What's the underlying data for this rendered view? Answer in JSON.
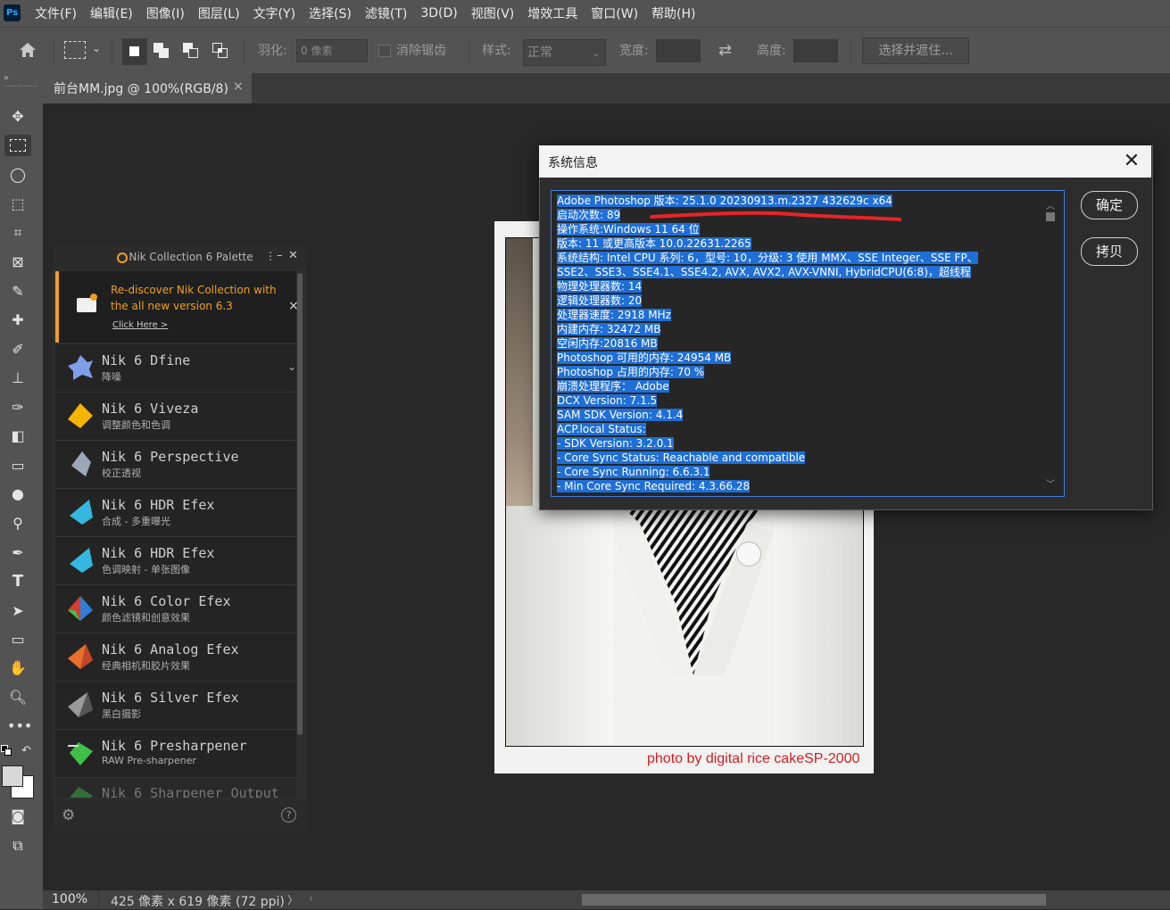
{
  "app": {
    "logo": "Ps"
  },
  "menu": [
    "文件(F)",
    "编辑(E)",
    "图像(I)",
    "图层(L)",
    "文字(Y)",
    "选择(S)",
    "滤镜(T)",
    "3D(D)",
    "视图(V)",
    "增效工具",
    "窗口(W)",
    "帮助(H)"
  ],
  "options": {
    "feather_label": "羽化:",
    "feather_value": "0 像素",
    "antialias_label": "消除锯齿",
    "style_label": "样式:",
    "style_value": "正常",
    "width_label": "宽度:",
    "height_label": "高度:",
    "select_mask_label": "选择并遮住..."
  },
  "tab": {
    "title": "前台MM.jpg @ 100%(RGB/8)",
    "close": "×"
  },
  "nik": {
    "title": "Nik Collection 6 Palette",
    "banner_line1": "Re-discover Nik Collection with",
    "banner_line2": "the all new version 6.3",
    "banner_link": "Click Here >",
    "banner_close": "×",
    "items": [
      {
        "name": "Nik 6 Dfine",
        "sub": "降噪",
        "color": "#7d9fe8"
      },
      {
        "name": "Nik 6 Viveza",
        "sub": "调整颜色和色调",
        "color": "#f5b400"
      },
      {
        "name": "Nik 6 Perspective",
        "sub": "校正透视",
        "color": "#9aa7b6"
      },
      {
        "name": "Nik 6 HDR Efex",
        "sub": "合成 - 多重曝光",
        "color": "#34b8e0"
      },
      {
        "name": "Nik 6 HDR Efex",
        "sub": "色调映射 - 单张图像",
        "color": "#34b8e0"
      },
      {
        "name": "Nik 6 Color Efex",
        "sub": "颜色滤镜和创意效果",
        "color": "#d83b2f"
      },
      {
        "name": "Nik 6 Analog Efex",
        "sub": "经典相机和胶片效果",
        "color": "#e8702a"
      },
      {
        "name": "Nik 6 Silver Efex",
        "sub": "黑白摄影",
        "color": "#9a9a9a"
      },
      {
        "name": "Nik 6 Presharpener",
        "sub": "RAW Pre-sharpener",
        "color": "#3fbf4a"
      },
      {
        "name": "Nik 6 Sharpener Output",
        "sub": "",
        "color": "#3fbf4a"
      }
    ]
  },
  "photo": {
    "caption": "photo by digital rice cakeSP-2000"
  },
  "status": {
    "zoom": "100%",
    "doc_info": "425 像素 x 619 像素 (72 ppi)",
    "arrow": "〉"
  },
  "dialog": {
    "title": "系统信息",
    "close": "✕",
    "ok": "确定",
    "copy": "拷贝",
    "lines": [
      "Adobe Photoshop 版本: 25.1.0 20230913.m.2327 432629c  x64",
      "启动次数: 89",
      "操作系统:Windows 11 64 位",
      "版本: 11 或更高版本 10.0.22631.2265",
      "系统结构: Intel CPU 系列: 6，型号: 10，分级: 3 使用 MMX、SSE Integer、SSE FP、",
      "SSE2、SSE3、SSE4.1、SSE4.2, AVX, AVX2, AVX-VNNI, HybridCPU(6:8)，超线程",
      "物理处理器数: 14",
      "逻辑处理器数: 20",
      "处理器速度: 2918 MHz",
      "内建内存: 32472 MB",
      "空闲内存:20816 MB",
      "Photoshop 可用的内存: 24954 MB",
      "Photoshop 占用的内存: 70 %",
      "崩溃处理程序： Adobe",
      "DCX Version: 7.1.5",
      "SAM SDK Version: 4.1.4",
      "ACP.local Status:",
      " - SDK Version: 3.2.0.1",
      " - Core Sync Status: Reachable and compatible",
      " - Core Sync Running: 6.6.3.1",
      " - Min Core Sync Required: 4.3.66.28"
    ]
  }
}
